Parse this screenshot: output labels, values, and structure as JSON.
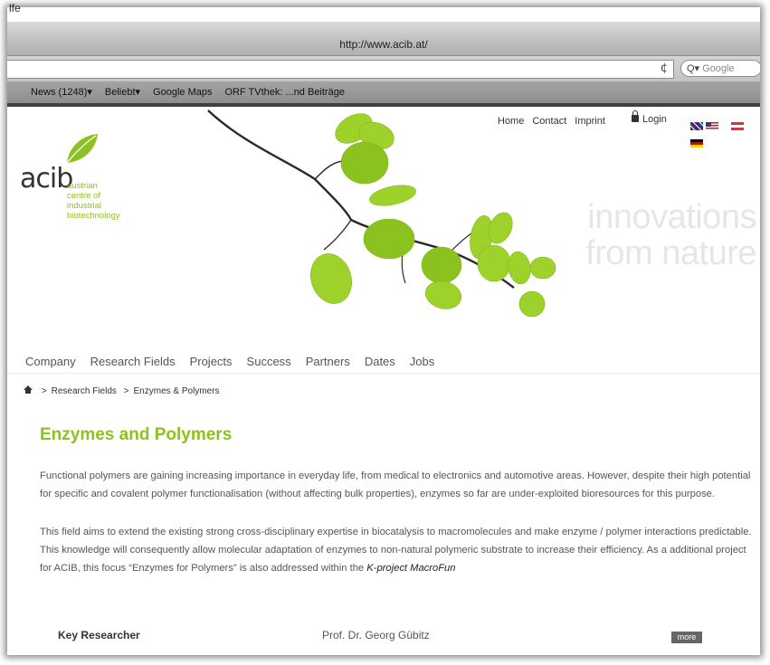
{
  "window_label": "lfe",
  "browser": {
    "title_url": "http://www.acib.at/",
    "reload_glyph": "¢",
    "search_placeholder": "Google",
    "search_prefix": "Q▾",
    "bookmarks": [
      "News (1248)▾",
      "Beliebt▾",
      "Google Maps",
      "ORF TVthek: ...nd Beiträge"
    ]
  },
  "site": {
    "logo_word": "acib",
    "logo_sub": [
      "austrian",
      "centre of",
      "industrial",
      "biotechnology"
    ],
    "top_links": [
      "Home",
      "Contact",
      "Imprint"
    ],
    "login_label": "Login",
    "tagline": [
      "innovations",
      "from nature"
    ],
    "nav": [
      "Company",
      "Research Fields",
      "Projects",
      "Success",
      "Partners",
      "Dates",
      "Jobs"
    ],
    "breadcrumb": [
      "Research Fields",
      "Enzymes & Polymers"
    ],
    "breadcrumb_sep": ">",
    "heading": "Enzymes and Polymers",
    "para1": "Functional polymers are gaining increasing importance in everyday life, from medical to electronics and automotive areas. However, despite their high potential for specific and covalent polymer functionalisation (without affecting bulk properties), enzymes so far are under-exploited bioresources for this purpose.",
    "para2": "This field aims to extend the existing strong cross-disciplinary expertise in biocatalysis to macromolecules and make enzyme / polymer interactions predictable. This knowledge will consequently allow molecular adaptation of enzymes to non-natural polymeric substrate to increase their efficiency. As a additional project for ACIB, this focus “Enzymes for Polymers” is also addressed within the",
    "para2_link": "K-project MacroFun",
    "key_researcher_label": "Key Researcher",
    "key_researcher_name": "Prof. Dr. Georg Gübitz",
    "more_label": "more"
  },
  "colors": {
    "brand_green": "#8cc21f",
    "chrome_dark": "#3f3f3f"
  }
}
